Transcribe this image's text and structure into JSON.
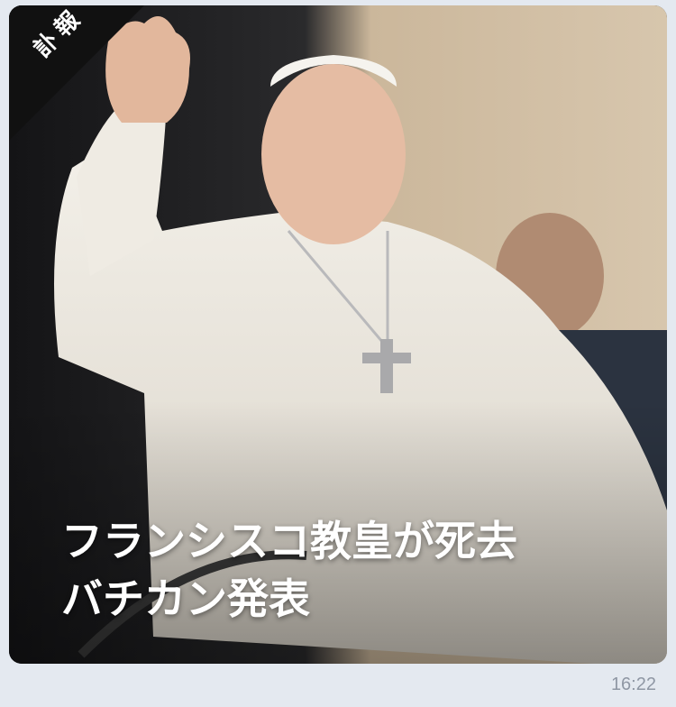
{
  "message": {
    "badge": "訃報",
    "headline_line1": "フランシスコ教皇が死去",
    "headline_line2": "バチカン発表",
    "timestamp": "16:22"
  },
  "colors": {
    "background": "#e4e9f0",
    "badge_bg": "#111111",
    "headline_text": "#ffffff",
    "timestamp_text": "#8f97a4"
  }
}
